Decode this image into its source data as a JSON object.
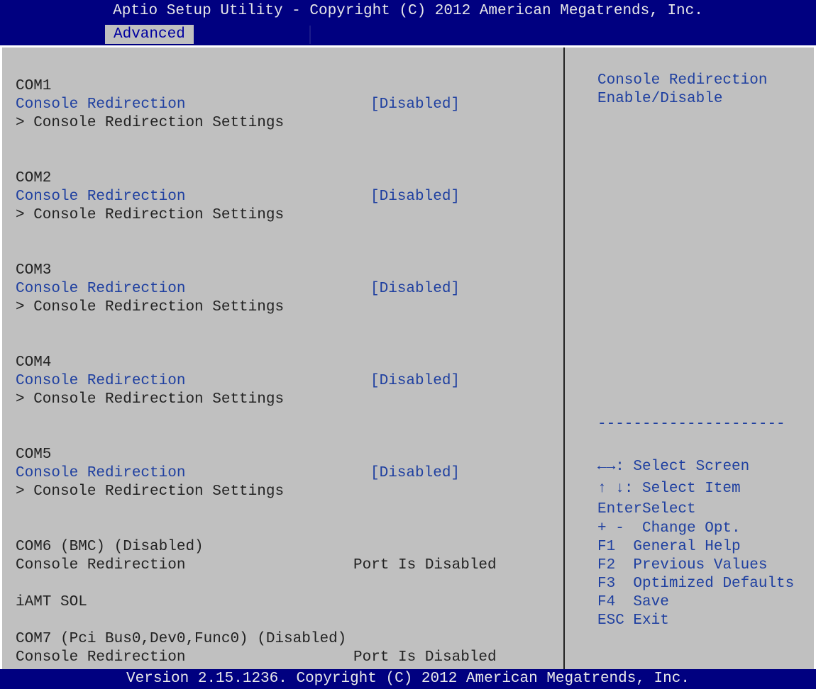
{
  "window": {
    "title": "Aptio Setup Utility - Copyright (C) 2012 American Megatrends, Inc.",
    "active_tab": "Advanced"
  },
  "main": {
    "com1": {
      "heading": "COM1",
      "item": "Console Redirection",
      "value": "[Disabled]",
      "submenu": "> Console Redirection Settings"
    },
    "com2": {
      "heading": "COM2",
      "item": "Console Redirection",
      "value": "[Disabled]",
      "submenu": "> Console Redirection Settings"
    },
    "com3": {
      "heading": "COM3",
      "item": "Console Redirection",
      "value": "[Disabled]",
      "submenu": "> Console Redirection Settings"
    },
    "com4": {
      "heading": "COM4",
      "item": "Console Redirection",
      "value": "[Disabled]",
      "submenu": "> Console Redirection Settings"
    },
    "com5": {
      "heading": "COM5",
      "item": "Console Redirection",
      "value": "[Disabled]",
      "submenu": "> Console Redirection Settings"
    },
    "com6": {
      "heading": "COM6 (BMC) (Disabled)",
      "item": "Console Redirection",
      "value": "Port Is Disabled"
    },
    "iamt": {
      "heading": "iAMT SOL"
    },
    "com7": {
      "heading": "COM7 (Pci Bus0,Dev0,Func0) (Disabled)",
      "item": "Console Redirection",
      "value": "Port Is Disabled"
    }
  },
  "help": {
    "line1": "Console Redirection",
    "line2": "Enable/Disable",
    "separator": "---------------------"
  },
  "keys": [
    {
      "key": "←→",
      "action": ": Select Screen"
    },
    {
      "key": "↑ ↓",
      "action": ": Select Item"
    },
    {
      "key": "Enter",
      "action": "Select"
    },
    {
      "key": "+ -",
      "action": "  Change Opt."
    },
    {
      "key": "F1",
      "action": "  General Help"
    },
    {
      "key": "F2",
      "action": "  Previous Values"
    },
    {
      "key": "F3",
      "action": "  Optimized Defaults"
    },
    {
      "key": "F4",
      "action": "  Save"
    },
    {
      "key": "ESC",
      "action": " Exit"
    }
  ],
  "footer": {
    "text": "Version 2.15.1236. Copyright (C) 2012 American Megatrends, Inc."
  },
  "colors": {
    "header_bg": "#000080",
    "panel_bg": "#c0c0c0",
    "highlight_text": "#1e3fa0"
  }
}
